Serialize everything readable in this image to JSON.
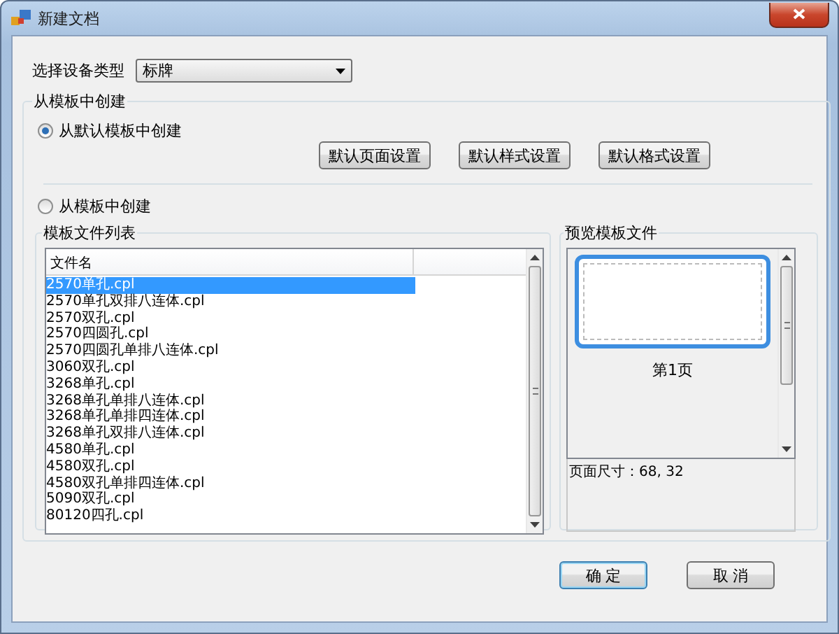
{
  "window": {
    "title": "新建文档"
  },
  "device_type": {
    "label": "选择设备类型",
    "value": "标牌"
  },
  "group": {
    "title": "从模板中创建"
  },
  "radios": [
    {
      "label": "从默认模板中创建",
      "selected": true
    },
    {
      "label": "从模板中创建",
      "selected": false
    }
  ],
  "default_buttons": [
    "默认页面设置",
    "默认样式设置",
    "默认格式设置"
  ],
  "file_list": {
    "title": "模板文件列表",
    "column": "文件名",
    "rows": [
      {
        "name": "2570单孔.cpl",
        "selected": true
      },
      {
        "name": "2570单孔双排八连体.cpl",
        "selected": false
      },
      {
        "name": "2570双孔.cpl",
        "selected": false
      },
      {
        "name": "2570四圆孔.cpl",
        "selected": false
      },
      {
        "name": "2570四圆孔单排八连体.cpl",
        "selected": false
      },
      {
        "name": "3060双孔.cpl",
        "selected": false
      },
      {
        "name": "3268单孔.cpl",
        "selected": false
      },
      {
        "name": "3268单孔单排八连体.cpl",
        "selected": false
      },
      {
        "name": "3268单孔单排四连体.cpl",
        "selected": false
      },
      {
        "name": "3268单孔双排八连体.cpl",
        "selected": false
      },
      {
        "name": "4580单孔.cpl",
        "selected": false
      },
      {
        "name": "4580双孔.cpl",
        "selected": false
      },
      {
        "name": "4580双孔单排四连体.cpl",
        "selected": false
      },
      {
        "name": "5090双孔.cpl",
        "selected": false
      },
      {
        "name": "80120四孔.cpl",
        "selected": false
      }
    ]
  },
  "preview": {
    "title": "预览模板文件",
    "page_label": "第1页",
    "page_size": "页面尺寸：68, 32"
  },
  "buttons": [
    {
      "label": "确 定",
      "default": true
    },
    {
      "label": "取 消",
      "default": false
    }
  ]
}
